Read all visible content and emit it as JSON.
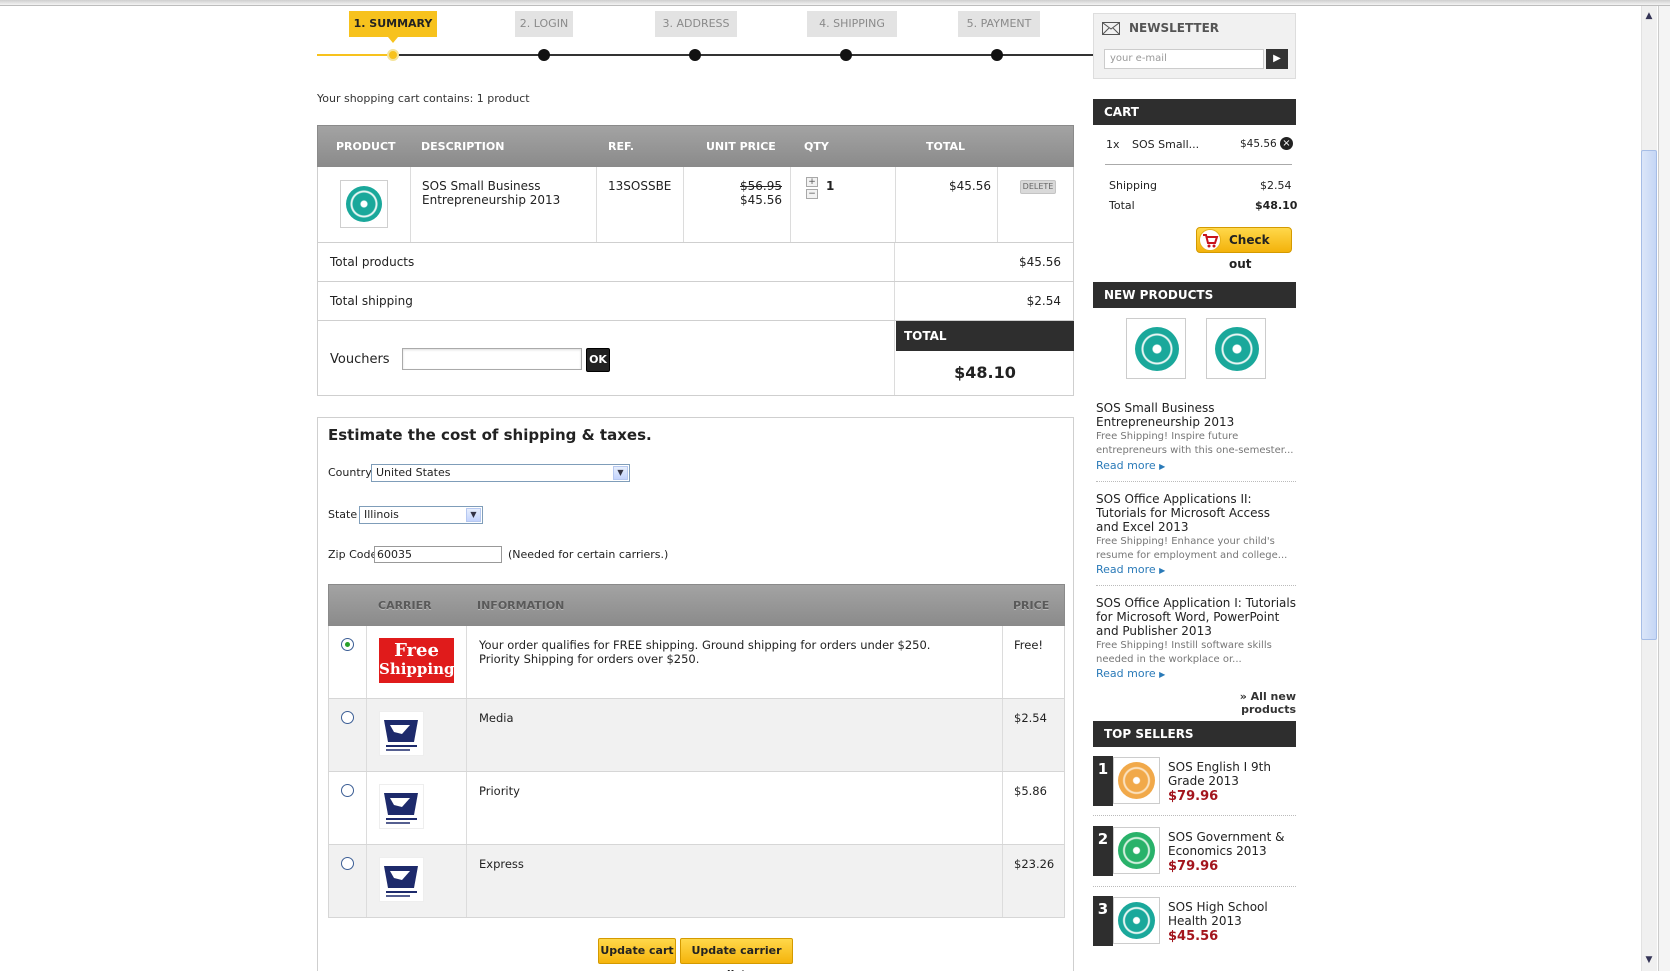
{
  "steps": [
    {
      "label": "1. SUMMARY",
      "active": true
    },
    {
      "label": "2. LOGIN",
      "active": false
    },
    {
      "label": "3. ADDRESS",
      "active": false
    },
    {
      "label": "4. SHIPPING",
      "active": false
    },
    {
      "label": "5. PAYMENT",
      "active": false
    }
  ],
  "cart_summary": "Your shopping cart contains: 1 product",
  "cart_table": {
    "headers": {
      "product": "PRODUCT",
      "description": "DESCRIPTION",
      "ref": "REF.",
      "unit_price": "UNIT PRICE",
      "qty": "QTY",
      "total": "TOTAL"
    },
    "item": {
      "description_line1": "SOS Small Business",
      "description_line2": "Entrepreneurship 2013",
      "ref": "13SOSSBE",
      "old_price": "$56.95",
      "price": "$45.56",
      "qty": "1",
      "total": "$45.56",
      "delete_label": "DELETE",
      "qty_plus": "+",
      "qty_minus": "−"
    }
  },
  "totals": {
    "products_label": "Total products",
    "products_value": "$45.56",
    "shipping_label": "Total shipping",
    "shipping_value": "$2.54",
    "vouchers_label": "Vouchers",
    "voucher_value": "",
    "ok_label": "OK",
    "total_label": "TOTAL",
    "total_value": "$48.10"
  },
  "estimate": {
    "title": "Estimate the cost of shipping & taxes.",
    "country_label": "Country",
    "country_value": "United States",
    "state_label": "State",
    "state_value": "Illinois",
    "zip_label": "Zip Code",
    "zip_value": "60035",
    "zip_note": "(Needed for certain carriers.)",
    "headers": {
      "carrier": "CARRIER",
      "information": "INFORMATION",
      "price": "PRICE"
    },
    "carriers": [
      {
        "logo": "free-shipping",
        "logo_line1": "Free",
        "logo_line2": "Shipping",
        "info": "Your order qualifies for FREE shipping. Ground shipping for orders under $250. Priority Shipping for orders over $250.",
        "price": "Free!",
        "selected": true
      },
      {
        "logo": "usps",
        "info": "Media",
        "price": "$2.54",
        "selected": false
      },
      {
        "logo": "usps",
        "info": "Priority",
        "price": "$5.86",
        "selected": false
      },
      {
        "logo": "usps",
        "info": "Express",
        "price": "$23.26",
        "selected": false
      }
    ],
    "update_cart_label": "Update cart",
    "update_carrier_label": "Update carrier list"
  },
  "sidebar": {
    "newsletter": {
      "title": "NEWSLETTER",
      "placeholder": "your e-mail"
    },
    "cart": {
      "title": "CART",
      "item_qty": "1x",
      "item_name": "SOS Small...",
      "item_price": "$45.56",
      "shipping_label": "Shipping",
      "shipping_value": "$2.54",
      "total_label": "Total",
      "total_value": "$48.10",
      "checkout_label": "Check out"
    },
    "new_products": {
      "title": "NEW PRODUCTS",
      "items": [
        {
          "title": "SOS Small Business Entrepreneurship 2013",
          "desc": "Free Shipping! Inspire future entrepreneurs with this one-semester..."
        },
        {
          "title": "SOS Office Applications II: Tutorials for Microsoft Access and Excel 2013",
          "desc": "Free Shipping! Enhance your child's resume for employment and college..."
        },
        {
          "title": "SOS Office Application I: Tutorials for Microsoft Word, PowerPoint and Publisher 2013",
          "desc": "Free Shipping! Instill software skills needed in the workplace or..."
        }
      ],
      "read_more": "Read more",
      "all_link": "» All new products"
    },
    "top_sellers": {
      "title": "TOP SELLERS",
      "items": [
        {
          "rank": "1",
          "title": "SOS English I 9th Grade 2013",
          "price": "$79.96"
        },
        {
          "rank": "2",
          "title": "SOS Government & Economics 2013",
          "price": "$79.96"
        },
        {
          "rank": "3",
          "title": "SOS High School Health 2013",
          "price": "$45.56"
        }
      ]
    }
  },
  "colors": {
    "accent": "#f7c21d",
    "dark": "#2e2e2e",
    "price_red": "#a3151d",
    "link": "#2a7ab8",
    "disc_teal": "#1aa89b",
    "disc_orange": "#f1a94a",
    "disc_green": "#29b26a"
  }
}
